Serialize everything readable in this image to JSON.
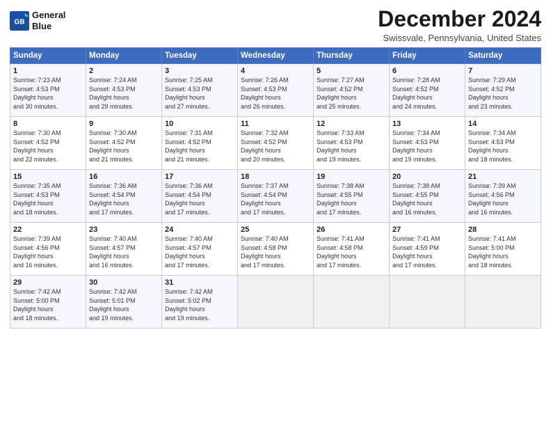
{
  "header": {
    "logo_line1": "General",
    "logo_line2": "Blue",
    "month_title": "December 2024",
    "location": "Swissvale, Pennsylvania, United States"
  },
  "weekdays": [
    "Sunday",
    "Monday",
    "Tuesday",
    "Wednesday",
    "Thursday",
    "Friday",
    "Saturday"
  ],
  "weeks": [
    [
      {
        "day": "1",
        "sunrise": "7:23 AM",
        "sunset": "4:53 PM",
        "daylight": "9 hours and 30 minutes."
      },
      {
        "day": "2",
        "sunrise": "7:24 AM",
        "sunset": "4:53 PM",
        "daylight": "9 hours and 29 minutes."
      },
      {
        "day": "3",
        "sunrise": "7:25 AM",
        "sunset": "4:53 PM",
        "daylight": "9 hours and 27 minutes."
      },
      {
        "day": "4",
        "sunrise": "7:26 AM",
        "sunset": "4:53 PM",
        "daylight": "9 hours and 26 minutes."
      },
      {
        "day": "5",
        "sunrise": "7:27 AM",
        "sunset": "4:52 PM",
        "daylight": "9 hours and 25 minutes."
      },
      {
        "day": "6",
        "sunrise": "7:28 AM",
        "sunset": "4:52 PM",
        "daylight": "9 hours and 24 minutes."
      },
      {
        "day": "7",
        "sunrise": "7:29 AM",
        "sunset": "4:52 PM",
        "daylight": "9 hours and 23 minutes."
      }
    ],
    [
      {
        "day": "8",
        "sunrise": "7:30 AM",
        "sunset": "4:52 PM",
        "daylight": "9 hours and 22 minutes."
      },
      {
        "day": "9",
        "sunrise": "7:30 AM",
        "sunset": "4:52 PM",
        "daylight": "9 hours and 21 minutes."
      },
      {
        "day": "10",
        "sunrise": "7:31 AM",
        "sunset": "4:52 PM",
        "daylight": "9 hours and 21 minutes."
      },
      {
        "day": "11",
        "sunrise": "7:32 AM",
        "sunset": "4:52 PM",
        "daylight": "9 hours and 20 minutes."
      },
      {
        "day": "12",
        "sunrise": "7:33 AM",
        "sunset": "4:53 PM",
        "daylight": "9 hours and 19 minutes."
      },
      {
        "day": "13",
        "sunrise": "7:34 AM",
        "sunset": "4:53 PM",
        "daylight": "9 hours and 19 minutes."
      },
      {
        "day": "14",
        "sunrise": "7:34 AM",
        "sunset": "4:53 PM",
        "daylight": "9 hours and 18 minutes."
      }
    ],
    [
      {
        "day": "15",
        "sunrise": "7:35 AM",
        "sunset": "4:53 PM",
        "daylight": "9 hours and 18 minutes."
      },
      {
        "day": "16",
        "sunrise": "7:36 AM",
        "sunset": "4:54 PM",
        "daylight": "9 hours and 17 minutes."
      },
      {
        "day": "17",
        "sunrise": "7:36 AM",
        "sunset": "4:54 PM",
        "daylight": "9 hours and 17 minutes."
      },
      {
        "day": "18",
        "sunrise": "7:37 AM",
        "sunset": "4:54 PM",
        "daylight": "9 hours and 17 minutes."
      },
      {
        "day": "19",
        "sunrise": "7:38 AM",
        "sunset": "4:55 PM",
        "daylight": "9 hours and 17 minutes."
      },
      {
        "day": "20",
        "sunrise": "7:38 AM",
        "sunset": "4:55 PM",
        "daylight": "9 hours and 16 minutes."
      },
      {
        "day": "21",
        "sunrise": "7:39 AM",
        "sunset": "4:56 PM",
        "daylight": "9 hours and 16 minutes."
      }
    ],
    [
      {
        "day": "22",
        "sunrise": "7:39 AM",
        "sunset": "4:56 PM",
        "daylight": "9 hours and 16 minutes."
      },
      {
        "day": "23",
        "sunrise": "7:40 AM",
        "sunset": "4:57 PM",
        "daylight": "9 hours and 16 minutes."
      },
      {
        "day": "24",
        "sunrise": "7:40 AM",
        "sunset": "4:57 PM",
        "daylight": "9 hours and 17 minutes."
      },
      {
        "day": "25",
        "sunrise": "7:40 AM",
        "sunset": "4:58 PM",
        "daylight": "9 hours and 17 minutes."
      },
      {
        "day": "26",
        "sunrise": "7:41 AM",
        "sunset": "4:58 PM",
        "daylight": "9 hours and 17 minutes."
      },
      {
        "day": "27",
        "sunrise": "7:41 AM",
        "sunset": "4:59 PM",
        "daylight": "9 hours and 17 minutes."
      },
      {
        "day": "28",
        "sunrise": "7:41 AM",
        "sunset": "5:00 PM",
        "daylight": "9 hours and 18 minutes."
      }
    ],
    [
      {
        "day": "29",
        "sunrise": "7:42 AM",
        "sunset": "5:00 PM",
        "daylight": "9 hours and 18 minutes."
      },
      {
        "day": "30",
        "sunrise": "7:42 AM",
        "sunset": "5:01 PM",
        "daylight": "9 hours and 19 minutes."
      },
      {
        "day": "31",
        "sunrise": "7:42 AM",
        "sunset": "5:02 PM",
        "daylight": "9 hours and 19 minutes."
      },
      null,
      null,
      null,
      null
    ]
  ],
  "labels": {
    "sunrise": "Sunrise:",
    "sunset": "Sunset:",
    "daylight": "Daylight hours"
  }
}
